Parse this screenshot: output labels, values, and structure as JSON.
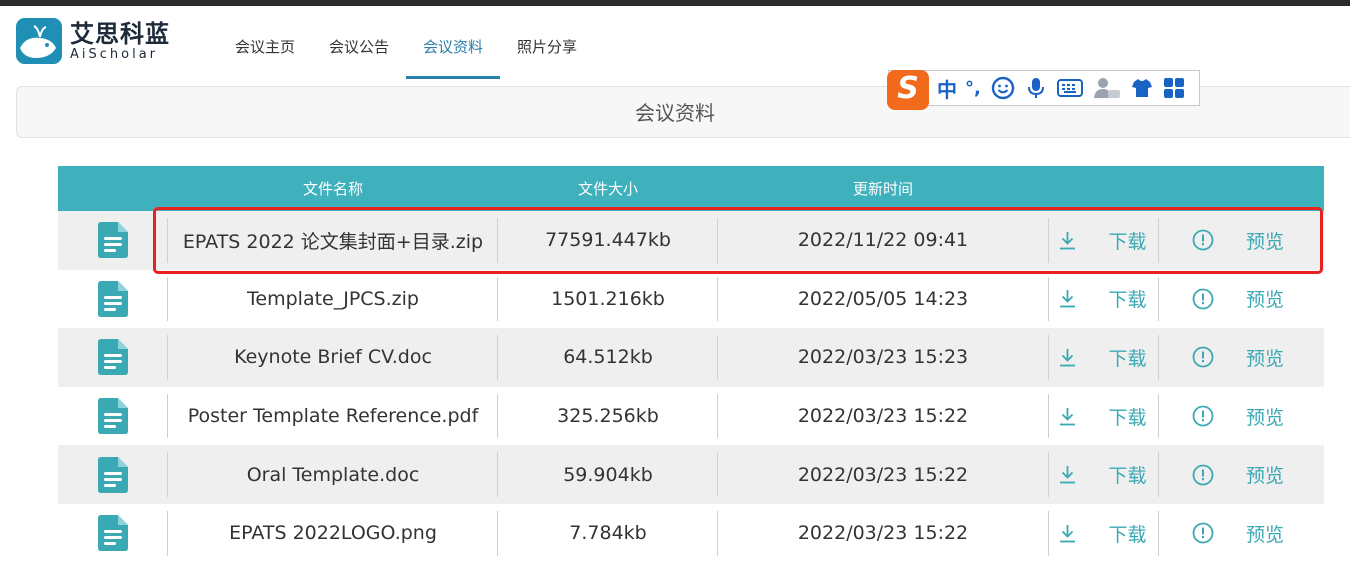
{
  "brand": {
    "name_cn": "艾思科蓝",
    "name_en": "AiScholar"
  },
  "nav": [
    {
      "label": "会议主页",
      "active": false
    },
    {
      "label": "会议公告",
      "active": false
    },
    {
      "label": "会议资料",
      "active": true
    },
    {
      "label": "照片分享",
      "active": false
    }
  ],
  "ime_toolbar": {
    "logo": "S",
    "mode": "中",
    "punct": "°,"
  },
  "page_title": "会议资料",
  "table": {
    "headers": [
      "文件名称",
      "文件大小",
      "更新时间"
    ],
    "download_label": "下载",
    "preview_label": "预览",
    "rows": [
      {
        "name": "EPATS 2022 论文集封面+目录.zip",
        "size": "77591.447kb",
        "time": "2022/11/22 09:41"
      },
      {
        "name": "Template_JPCS.zip",
        "size": "1501.216kb",
        "time": "2022/05/05 14:23"
      },
      {
        "name": "Keynote Brief CV.doc",
        "size": "64.512kb",
        "time": "2022/03/23 15:23"
      },
      {
        "name": "Poster Template Reference.pdf",
        "size": "325.256kb",
        "time": "2022/03/23 15:22"
      },
      {
        "name": "Oral Template.doc",
        "size": "59.904kb",
        "time": "2022/03/23 15:22"
      },
      {
        "name": "EPATS 2022LOGO.png",
        "size": "7.784kb",
        "time": "2022/03/23 15:22"
      }
    ]
  },
  "colors": {
    "accent": "#3fb1bd",
    "nav_active": "#2a7fa8",
    "highlight": "#e8231f"
  }
}
